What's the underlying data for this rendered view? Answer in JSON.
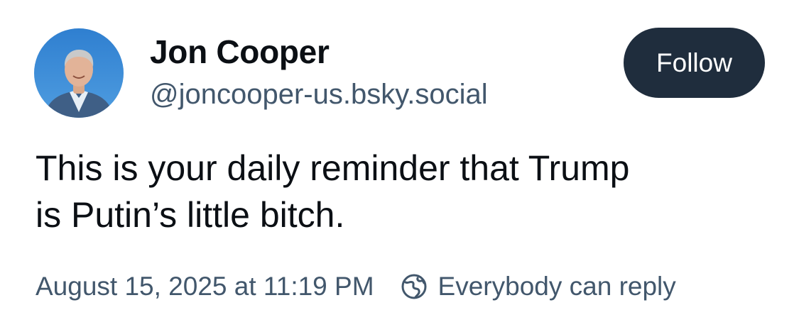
{
  "author": {
    "display_name": "Jon Cooper",
    "handle": "@joncooper-us.bsky.social"
  },
  "follow_button": {
    "label": "Follow"
  },
  "post": {
    "text": "This is your daily reminder that Trump\nis Putin’s little bitch."
  },
  "meta": {
    "timestamp": "August 15, 2025 at 11:19 PM",
    "reply_setting": "Everybody can reply",
    "reply_icon": "globe-icon"
  },
  "colors": {
    "follow_bg": "#1f2d3d",
    "secondary_text": "#42576c",
    "primary_text": "#0b0f14"
  }
}
